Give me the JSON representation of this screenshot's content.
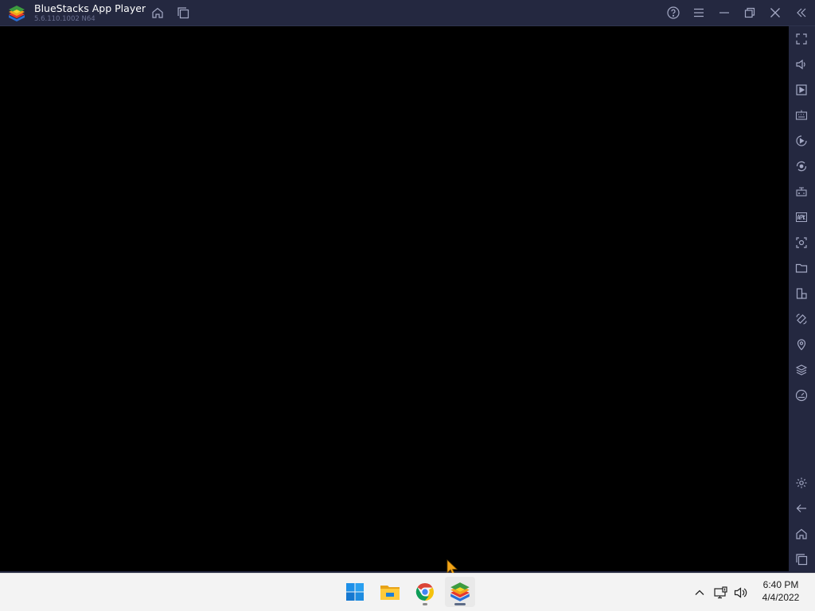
{
  "window": {
    "app_title": "BlueStacks App Player",
    "version": "5.6.110.1002 N64",
    "titlebar_buttons": [
      "home-icon",
      "multi-instance-icon",
      "help-icon",
      "menu-icon",
      "minimize-icon",
      "restore-icon",
      "close-icon",
      "collapse-sidebar-icon"
    ]
  },
  "sidebar": {
    "top_tools": [
      "fullscreen-icon",
      "volume-icon",
      "media-manager-icon",
      "keyboard-controls-icon",
      "macro-recorder-icon",
      "sync-icon",
      "game-controls-icon",
      "install-apk-icon",
      "screenshot-icon",
      "folder-icon",
      "multi-instance-icon",
      "rotate-icon",
      "location-icon",
      "layers-icon",
      "eco-mode-icon"
    ],
    "bottom_tools": [
      "settings-icon",
      "back-icon",
      "home-icon",
      "recent-apps-icon"
    ]
  },
  "taskbar": {
    "pinned": [
      "windows-start-icon",
      "file-explorer-icon",
      "chrome-icon",
      "bluestacks-icon"
    ],
    "tray": [
      "show-hidden-icons-icon",
      "network-icon",
      "speaker-icon"
    ],
    "time": "6:40 PM",
    "date": "4/4/2022"
  },
  "colors": {
    "chrome_bg": "#242840",
    "icon_gray": "#a4a9c4",
    "screen_bg": "#000000",
    "taskbar_bg": "#f3f3f3"
  }
}
